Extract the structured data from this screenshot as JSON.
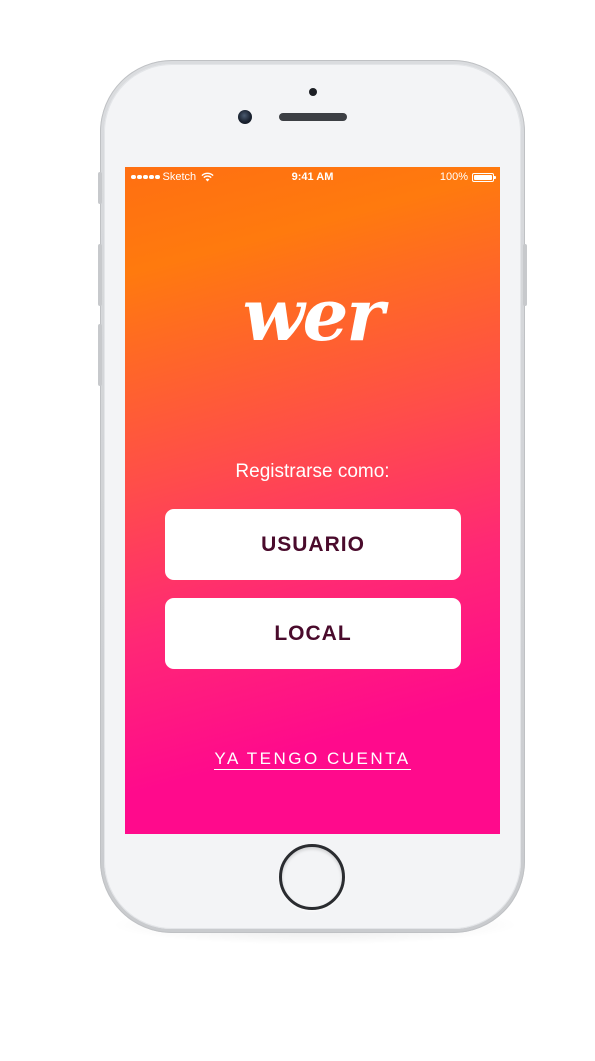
{
  "status_bar": {
    "carrier": "Sketch",
    "time": "9:41 AM",
    "battery": "100%",
    "battery_level": 1.0
  },
  "logo": "wer",
  "register_label": "Registrarse como:",
  "buttons": {
    "usuario": "USUARIO",
    "local": "LOCAL"
  },
  "login_link": "YA TENGO CUENTA",
  "icons": [
    "signal-dots-icon",
    "wifi-icon",
    "battery-icon"
  ],
  "colors": {
    "gradient_top": "#ff7a0e",
    "gradient_bottom": "#ff0a8c",
    "button_text": "#4a0b2c",
    "button_bg": "#ffffff"
  }
}
